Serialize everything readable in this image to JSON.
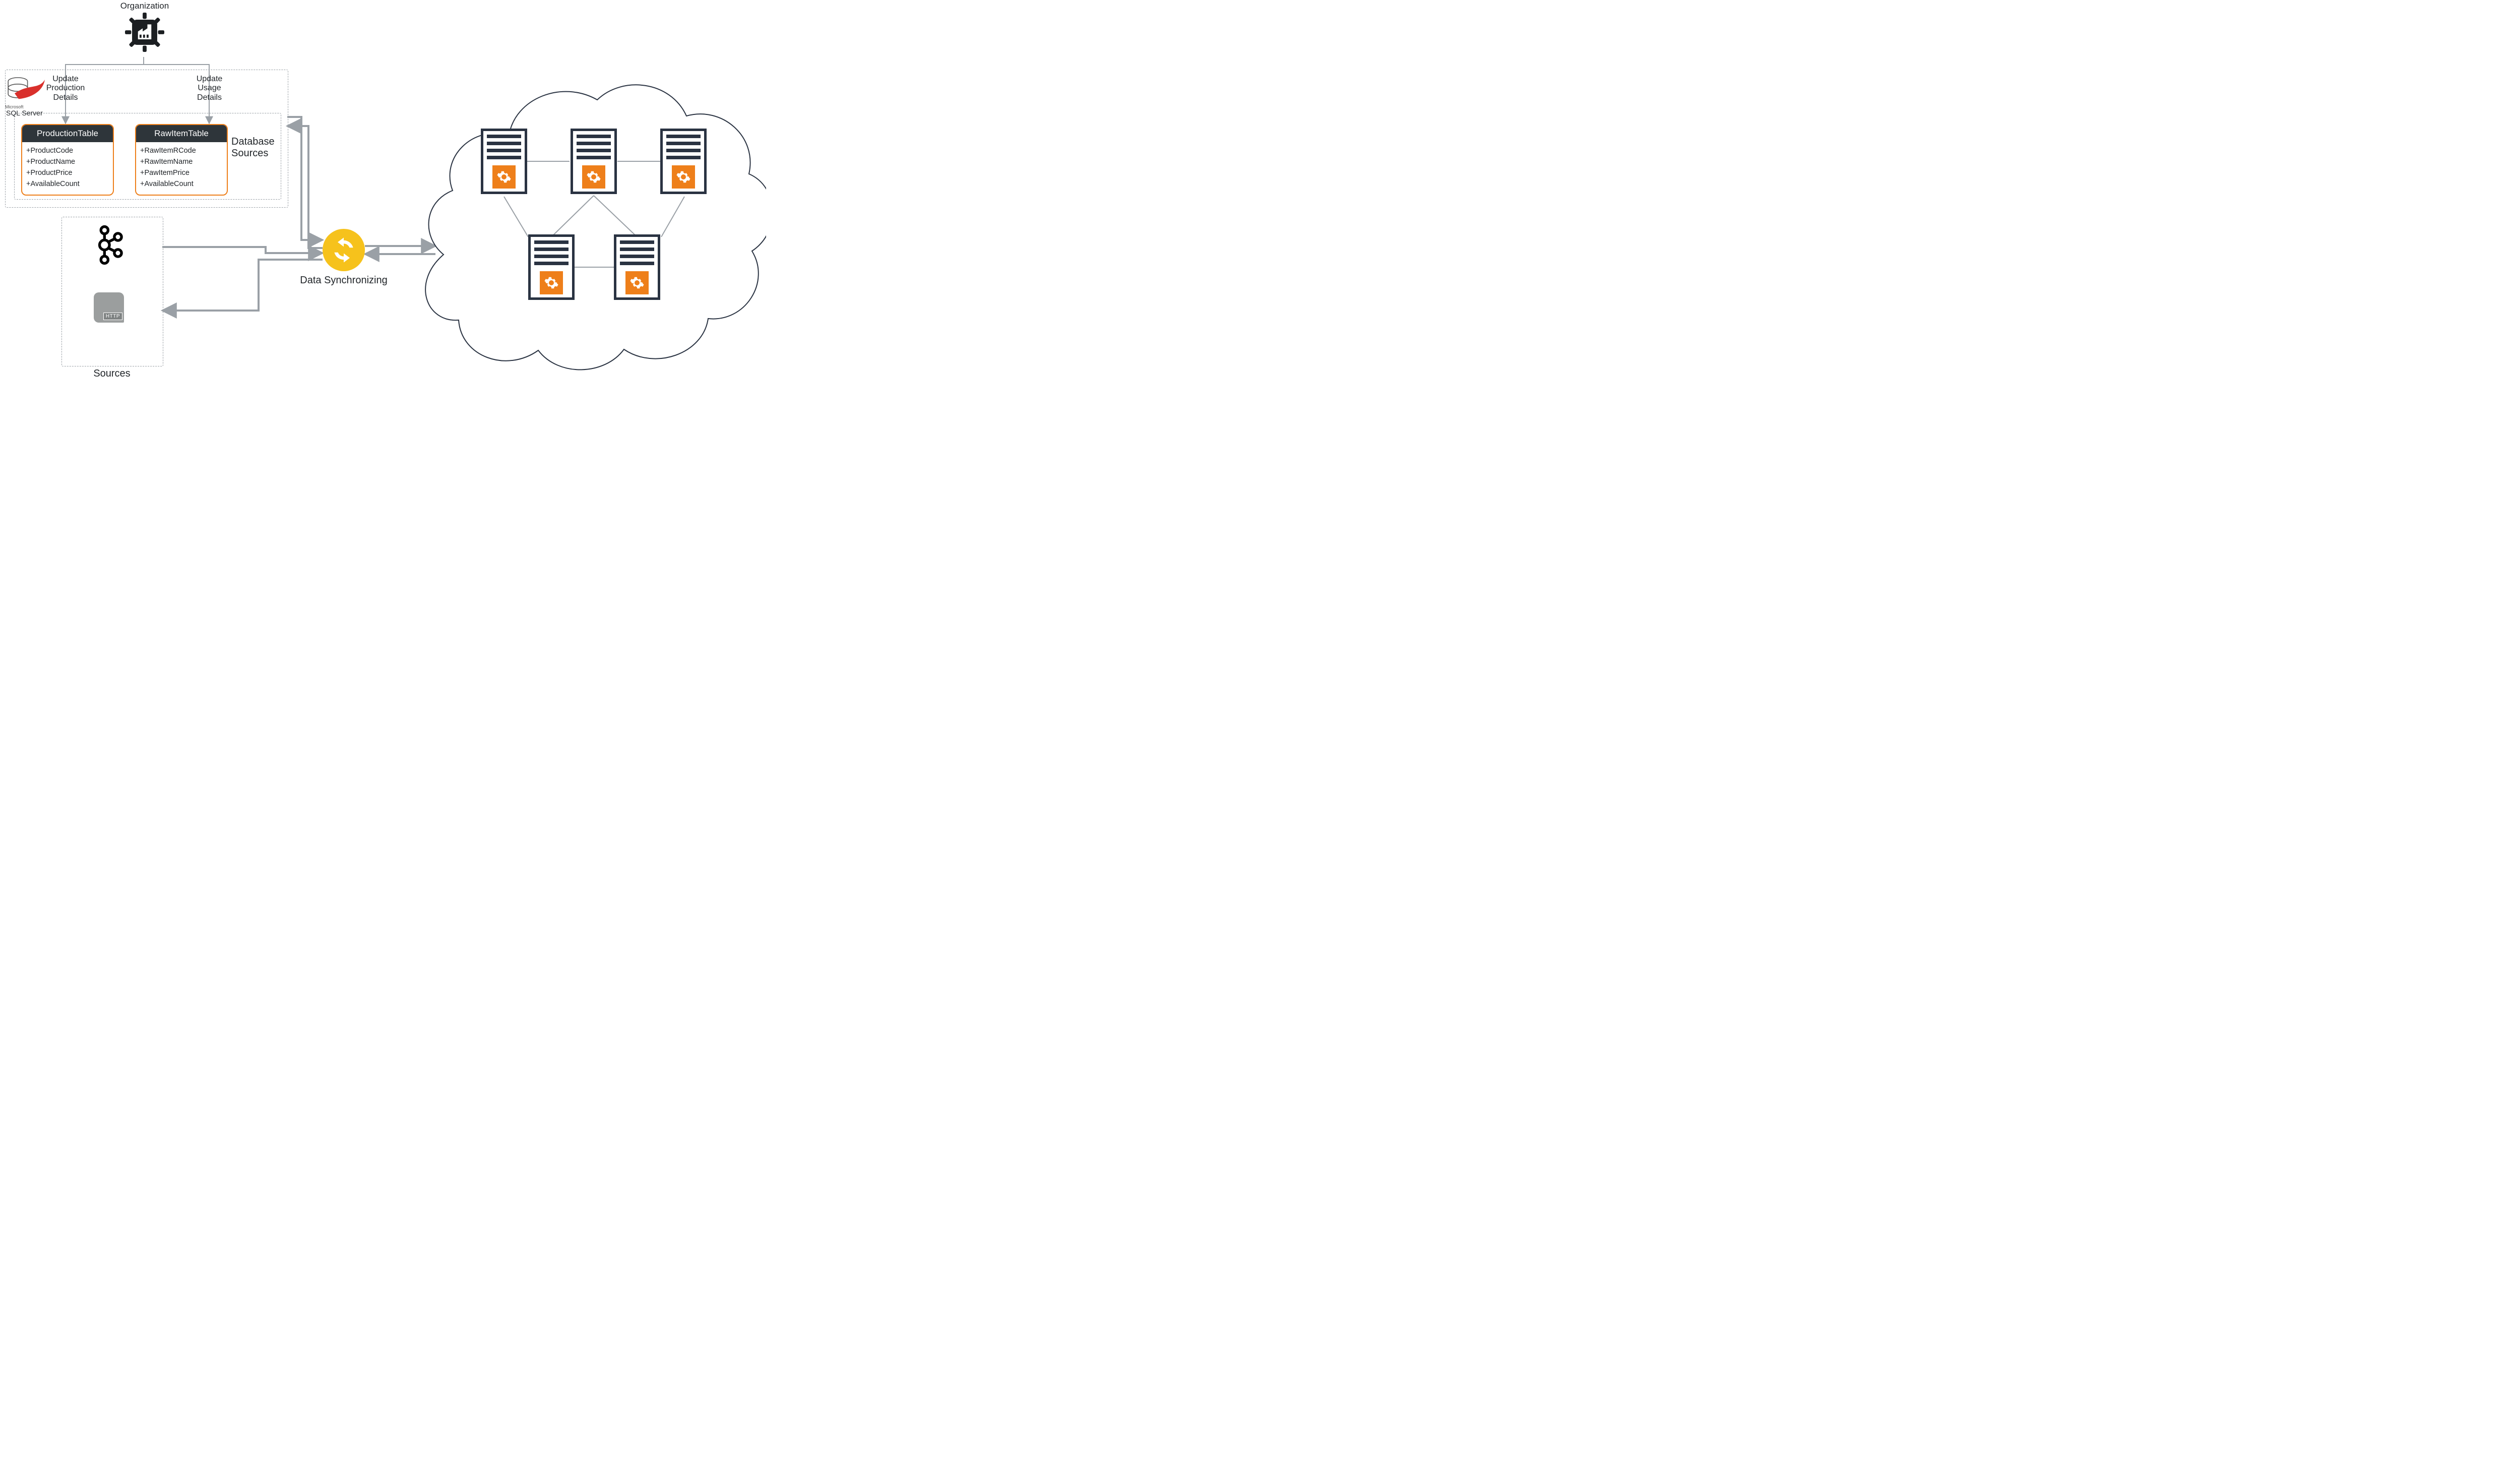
{
  "labels": {
    "organization": "Organization",
    "update_production": "Update\nProduction\nDetails",
    "update_usage": "Update\nUsage\nDetails",
    "database_sources": "Database\nSources",
    "data_sync": "Data Synchronizing",
    "sources": "Sources",
    "sql_server": "SQL Server",
    "sql_server_vendor": "Microsoft",
    "http_tag": "HTTP"
  },
  "tables": {
    "production": {
      "title": "ProductionTable",
      "fields": [
        "+ProductCode",
        "+ProductName",
        "+ProductPrice",
        "+AvailableCount"
      ]
    },
    "rawitem": {
      "title": "RawItemTable",
      "fields": [
        "+RawItemRCode",
        "+RawItemName",
        "+PawItemPrice",
        "+AvailableCount"
      ]
    }
  },
  "colors": {
    "accent_orange": "#ee7f1a",
    "sync_yellow": "#f6c21c",
    "server_navy": "#2a3342",
    "arrow_gray": "#9aa0a6",
    "table_header_bg": "#2e353a"
  }
}
